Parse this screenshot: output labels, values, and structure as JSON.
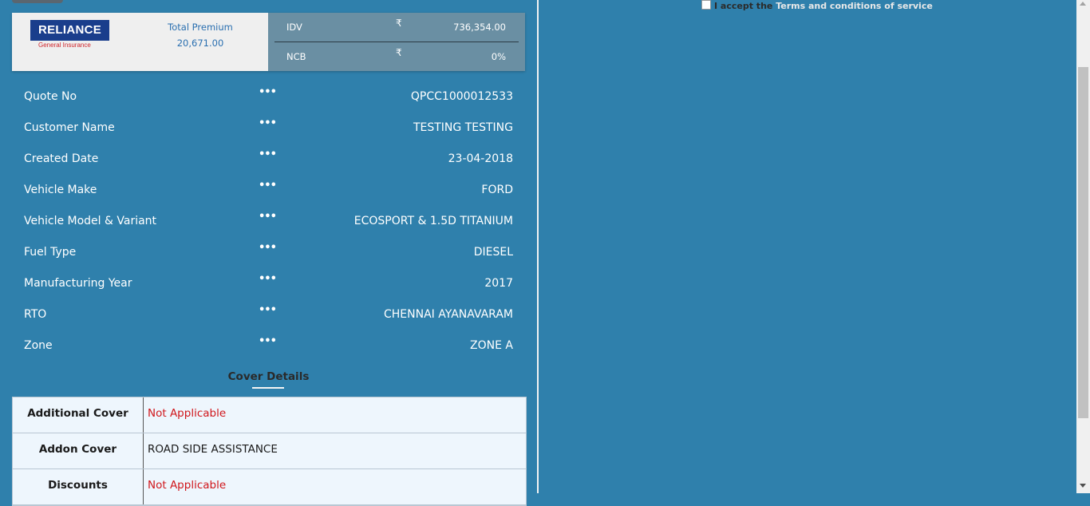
{
  "header": {
    "logo_text": "RELIANCE",
    "logo_subtext": "General Insurance",
    "total_premium_label": "Total Premium",
    "total_premium_value": "20,671.00",
    "stats": [
      {
        "label": "IDV",
        "currency": "₹",
        "value": "736,354.00"
      },
      {
        "label": "NCB",
        "currency": "₹",
        "value": "0%"
      }
    ]
  },
  "details": [
    {
      "label": "Quote No",
      "sep": "•••",
      "value": "QPCC1000012533"
    },
    {
      "label": "Customer Name",
      "sep": "•••",
      "value": "TESTING TESTING"
    },
    {
      "label": "Created Date",
      "sep": "•••",
      "value": "23-04-2018"
    },
    {
      "label": "Vehicle Make",
      "sep": "•••",
      "value": "FORD"
    },
    {
      "label": "Vehicle Model & Variant",
      "sep": "•••",
      "value": "ECOSPORT & 1.5D TITANIUM"
    },
    {
      "label": "Fuel Type",
      "sep": "•••",
      "value": "DIESEL"
    },
    {
      "label": "Manufacturing Year",
      "sep": "•••",
      "value": "2017"
    },
    {
      "label": "RTO",
      "sep": "•••",
      "value": "CHENNAI AYANAVARAM"
    },
    {
      "label": "Zone",
      "sep": "•••",
      "value": "ZONE A"
    }
  ],
  "cover": {
    "title": "Cover Details",
    "rows": [
      {
        "key": "Additional Cover",
        "value": "Not Applicable"
      },
      {
        "key": "Addon Cover",
        "value": "ROAD SIDE ASSISTANCE"
      },
      {
        "key": "Discounts",
        "value": "Not Applicable"
      }
    ]
  },
  "terms": {
    "prefix": "I accept the",
    "link": "Terms and conditions of service"
  },
  "colors": {
    "background": "#2f80ac",
    "not_applicable": "#d0161b",
    "premium_text": "#2a6fb0"
  }
}
